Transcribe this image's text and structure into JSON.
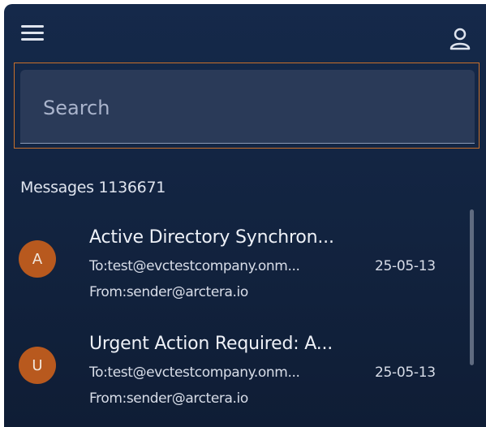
{
  "header": {
    "menu_icon": "hamburger-menu-icon",
    "user_icon": "user-account-icon"
  },
  "search": {
    "placeholder": "Search",
    "value": ""
  },
  "messages": {
    "count_label": "Messages 1136671",
    "items": [
      {
        "avatar_letter": "A",
        "subject": "Active Directory Synchron...",
        "to": "To:test@evctestcompany.onm...",
        "date": "25-05-13",
        "from": "From:sender@arctera.io"
      },
      {
        "avatar_letter": "U",
        "subject": "Urgent Action Required: A...",
        "to": "To:test@evctestcompany.onm...",
        "date": "25-05-13",
        "from": "From:sender@arctera.io"
      }
    ]
  },
  "colors": {
    "background": "#12233f",
    "accent_border": "#c9702a",
    "avatar": "#b8591e"
  }
}
